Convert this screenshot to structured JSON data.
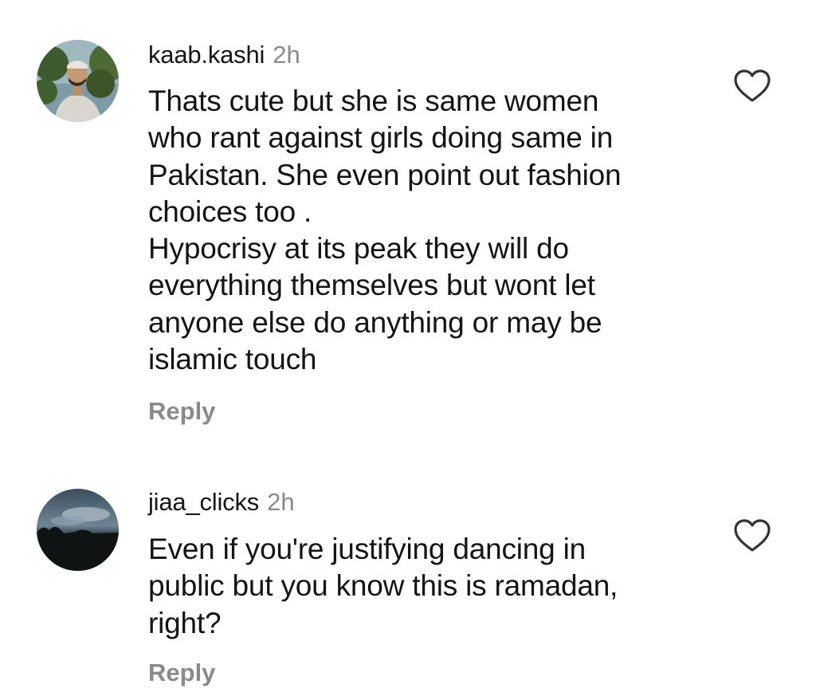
{
  "comments": [
    {
      "username": "kaab.kashi",
      "time": "2h",
      "lines": [
        "Thats cute but she is same women",
        "who rant against girls doing same in",
        "Pakistan. She even point out fashion",
        "choices too .",
        "Hypocrisy at its peak they will do",
        "everything themselves but wont let",
        "anyone else do anything or may be",
        "islamic touch"
      ],
      "reply_label": "Reply",
      "like_icon": "heart-outline-icon"
    },
    {
      "username": "jiaa_clicks",
      "time": "2h",
      "lines": [
        "Even if you're justifying dancing in",
        "public but you know this is ramadan,",
        "right?"
      ],
      "reply_label": "Reply",
      "like_icon": "heart-outline-icon"
    }
  ],
  "colors": {
    "username": "#151515",
    "secondary_text": "#8a8a8a",
    "body_text": "#141414",
    "icon_stroke": "#333333"
  }
}
